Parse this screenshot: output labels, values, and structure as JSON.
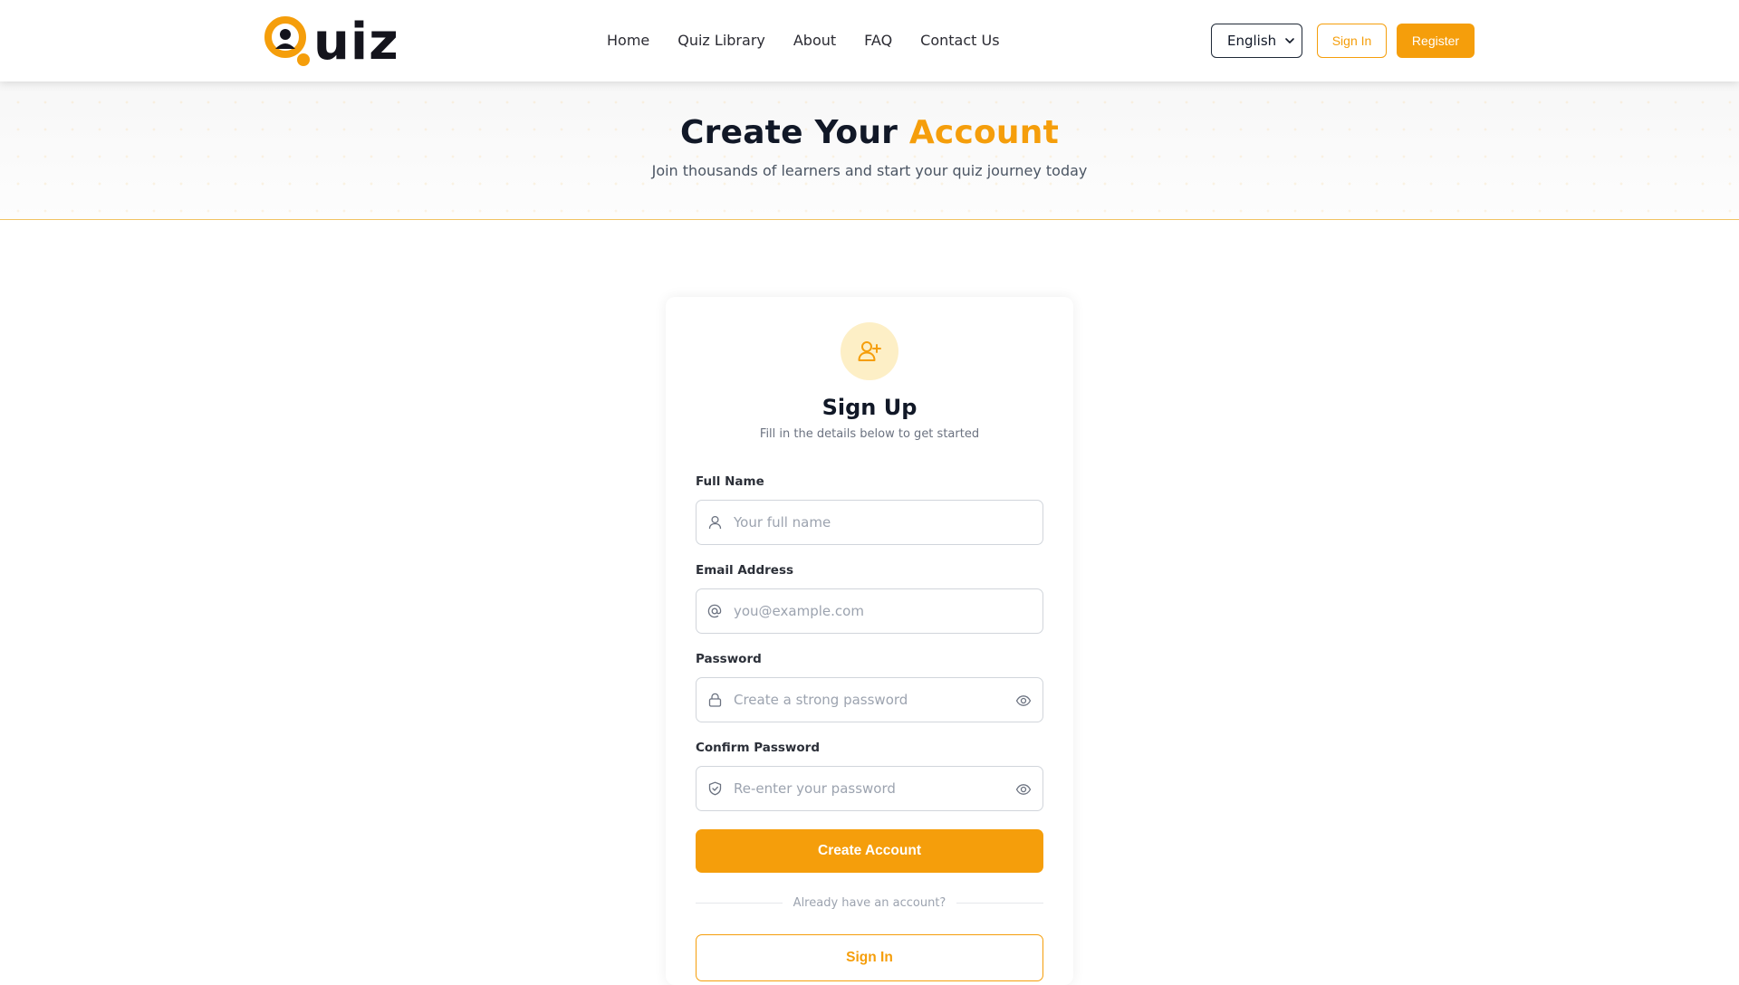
{
  "brand": {
    "logo_text": "uiz",
    "accent_color": "#f59e0b"
  },
  "nav": {
    "items": [
      {
        "label": "Home"
      },
      {
        "label": "Quiz Library"
      },
      {
        "label": "About"
      },
      {
        "label": "FAQ"
      },
      {
        "label": "Contact Us"
      }
    ],
    "language": "English",
    "sign_in_label": "Sign In",
    "register_label": "Register"
  },
  "hero": {
    "title_main": "Create Your ",
    "title_accent": "Account",
    "subtitle": "Join thousands of learners and start your quiz journey today"
  },
  "form": {
    "icon": "user-plus-icon",
    "title": "Sign Up",
    "subtitle": "Fill in the details below to get started",
    "full_name": {
      "label": "Full Name",
      "placeholder": "Your full name",
      "value": "",
      "icon": "user-icon"
    },
    "email": {
      "label": "Email Address",
      "placeholder": "you@example.com",
      "value": "",
      "icon": "at-icon"
    },
    "password": {
      "label": "Password",
      "placeholder": "Create a strong password",
      "value": "",
      "icon": "lock-icon"
    },
    "confirm_password": {
      "label": "Confirm Password",
      "placeholder": "Re-enter your password",
      "value": "",
      "icon": "shield-check-icon"
    },
    "submit_label": "Create Account",
    "divider_text": "Already have an account?",
    "signin_label": "Sign In"
  }
}
